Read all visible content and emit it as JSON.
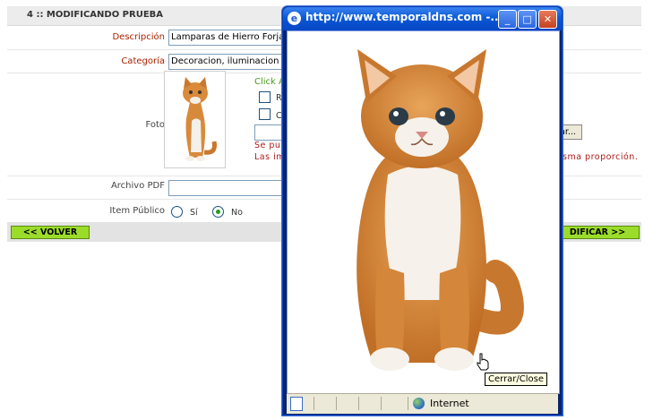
{
  "form": {
    "title": "4 :: MODIFICANDO PRUEBA",
    "description_label": "Descripción",
    "description_value": "Lamparas de Hierro Forjad",
    "category_label": "Categoría",
    "category_value": "Decoracion, iluminacion",
    "photo_label": "Foto",
    "click_text": "Click Ac",
    "option_r": "R",
    "option_c": "C",
    "browse_label": "ar...",
    "note_line1": "Se pu",
    "note_line2": "Las im",
    "note_tail": "sma proporción.",
    "pdf_label": "Archivo PDF",
    "public_label": "Item Público",
    "public_yes": "Sí",
    "public_no": "No",
    "public_selected": "No",
    "back_button": "<< VOLVER",
    "modify_button": "DIFICAR >>"
  },
  "popup": {
    "title": "http://www.temporaldns.com -...",
    "tooltip": "Cerrar/Close",
    "status_zone": "Internet",
    "image_subject": "kitten-photo"
  },
  "colors": {
    "green_button": "#9bdc2a",
    "title_bar": "#0a5ad6",
    "label_red": "#aa2200",
    "hint_green": "#4a9a1a"
  }
}
